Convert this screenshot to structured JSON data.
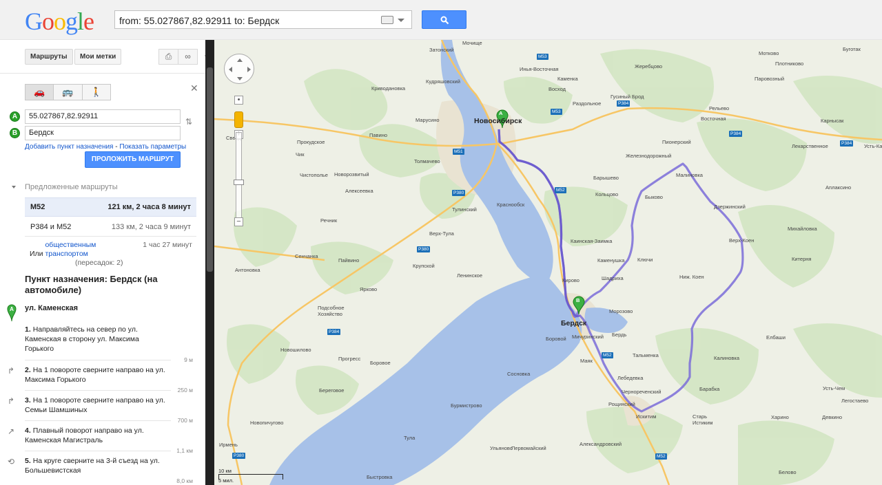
{
  "header": {
    "logo": "Google",
    "search_query": "from: 55.027867,82.92911 to: Бердск"
  },
  "panel": {
    "tabs": [
      "Маршруты",
      "Мои метки"
    ],
    "origin": "55.027867,82.92911",
    "destination": "Бердск",
    "add_destination": "Добавить пункт назначения",
    "separator": " - ",
    "show_options": "Показать параметры",
    "route_button": "ПРОЛОЖИТЬ МАРШРУТ",
    "suggested_title": "Предложенные маршруты",
    "routes": [
      {
        "name": "M52",
        "details": "121 км, 2 часа 8 минут"
      },
      {
        "name": "P384 и M52",
        "details": "133 км, 2 часа 9 минут"
      }
    ],
    "transit": {
      "prefix": "Или",
      "link": "общественным транспортом",
      "suffix": "(пересадок: 2)",
      "time": "1 час 27 минут"
    },
    "destination_title": "Пункт назначения: Бердск (на автомобиле)",
    "start_street": "ул. Каменская",
    "steps": [
      {
        "num": "1.",
        "text": "Направляйтесь на север по ул. Каменская в сторону ул. Максима Горького",
        "dist": "9 м"
      },
      {
        "num": "2.",
        "text": "На 1 повороте сверните направо на ул. Максима Горького",
        "dist": "250 м"
      },
      {
        "num": "3.",
        "text": "На 1 повороте сверните направо на ул. Семьи Шамшиных",
        "dist": "700 м"
      },
      {
        "num": "4.",
        "text": "Плавный поворот направо на ул. Каменская Магистраль",
        "dist": "1,1 км"
      },
      {
        "num": "5.",
        "text": "На круге сверните на 3-й съезд на ул. Большевистская",
        "dist": "8,0 км"
      }
    ]
  },
  "map": {
    "scale_km": "10 км",
    "scale_mi": "5 мил.",
    "marker_a": "A",
    "marker_b": "B",
    "cities": [
      "Новосибирск",
      "Бердск"
    ],
    "towns": [
      "Затонский",
      "Мочище",
      "Инья-Восточная",
      "Кудряшовский",
      "Каменка",
      "Криводановка",
      "Восход",
      "Раздольное",
      "Гусиный Брод",
      "Жеребцово",
      "Мотково",
      "Плотниково",
      "Буготак",
      "Паровозный",
      "Марусино",
      "Рельево",
      "Восточная",
      "Карнысак",
      "Павино",
      "Прокудское",
      "Пионерский",
      "Лекарственное",
      "Усть-Кам",
      "Чик",
      "Толмачево",
      "Железнодорожный",
      "Чистополье",
      "Новорозвитый",
      "Барышево",
      "Малиновка",
      "Алексеевка",
      "Кольцово",
      "Быково",
      "Аплаксино",
      "Тулинский",
      "Краснообск",
      "Дзержинский",
      "Речник",
      "Верх-Тула",
      "Каинская-Заимка",
      "Михайловка",
      "Верх-Коен",
      "Сенчанка",
      "Пайвино",
      "Крупской",
      "Каменушка",
      "Ключи",
      "Китерня",
      "Антоновка",
      "Ленинское",
      "Кирово",
      "Шадриха",
      "Ниж. Коен",
      "Ярково",
      "Подсобное Хозяйство",
      "Морозово",
      "Мичуринский",
      "Бердь",
      "Елбаши",
      "Боровой",
      "Новошилово",
      "Маяк",
      "Тальменка",
      "Калиновка",
      "Прогресс",
      "Боровое",
      "Лебедевка",
      "Барабка",
      "Сосновка",
      "Береговое",
      "Чернореченский",
      "Усть-Чем",
      "Легостаево",
      "Рощинский",
      "Бурмистрово",
      "Искитим",
      "Старь Истиким",
      "Харино",
      "Девкино",
      "Новопичугово",
      "Тула",
      "Ирмень",
      "Ульяново",
      "Первомайский",
      "Александровский",
      "Быстровка",
      "Белово",
      "Сверд"
    ],
    "road_shields": [
      "M53",
      "M53",
      "M51",
      "P380",
      "P380",
      "P380",
      "M52",
      "M52",
      "M52",
      "P384",
      "P384",
      "P384",
      "P384"
    ]
  }
}
